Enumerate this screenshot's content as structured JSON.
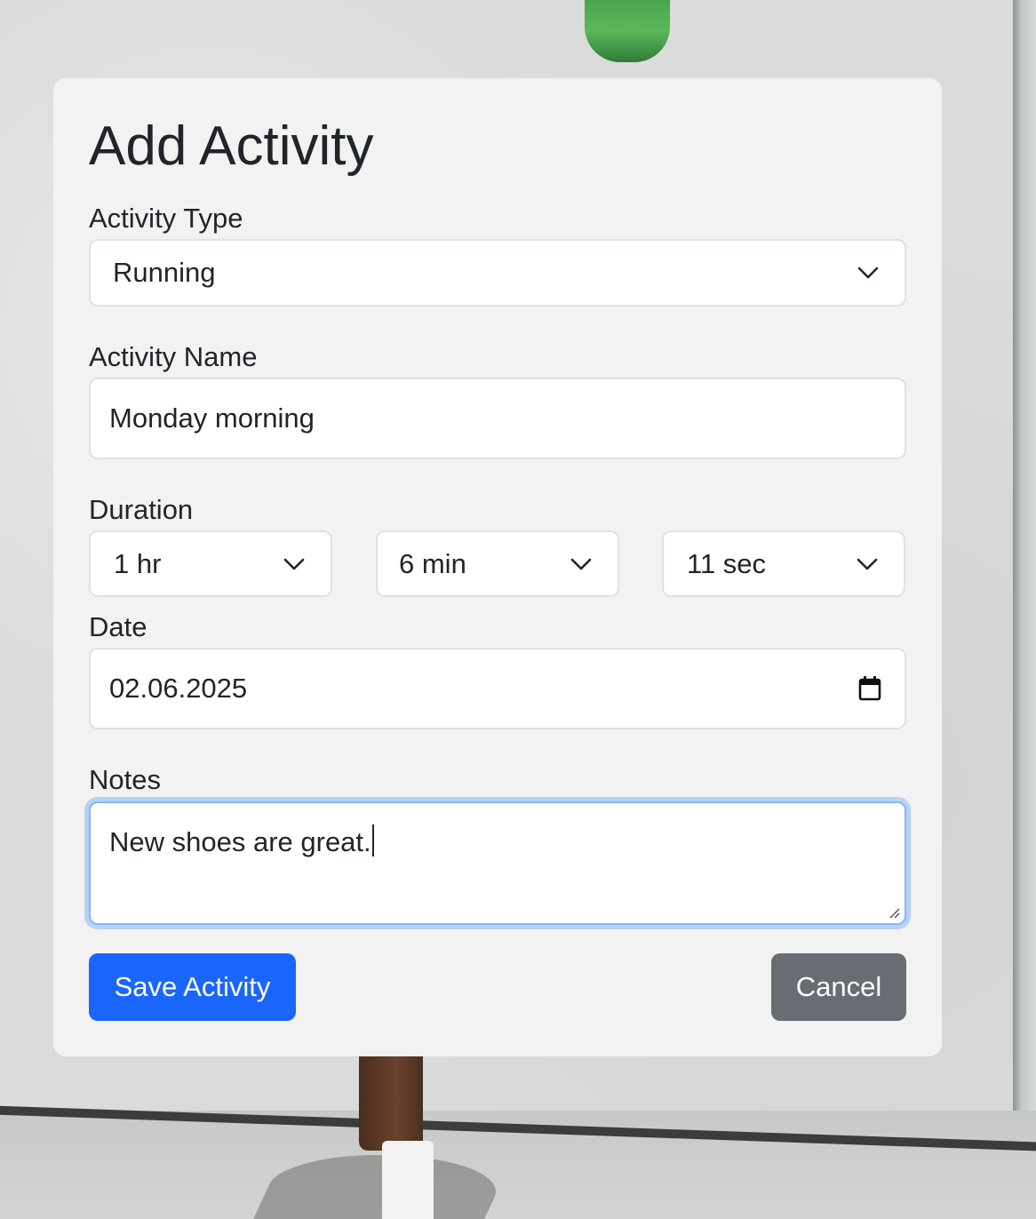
{
  "form": {
    "title": "Add Activity",
    "activity_type": {
      "label": "Activity Type",
      "value": "Running"
    },
    "activity_name": {
      "label": "Activity Name",
      "value": "Monday morning"
    },
    "duration": {
      "label": "Duration",
      "hours": "1 hr",
      "minutes": "6 min",
      "seconds": "11 sec"
    },
    "date": {
      "label": "Date",
      "value": "02.06.2025"
    },
    "notes": {
      "label": "Notes",
      "value": "New shoes are great."
    },
    "buttons": {
      "save": "Save Activity",
      "cancel": "Cancel"
    }
  },
  "colors": {
    "primary": "#1a66fb",
    "secondary": "#676d73",
    "card": "#f2f2f2",
    "focus": "#86b7fe"
  },
  "icons": [
    "chevron-down-icon",
    "calendar-icon",
    "resize-handle-icon"
  ]
}
